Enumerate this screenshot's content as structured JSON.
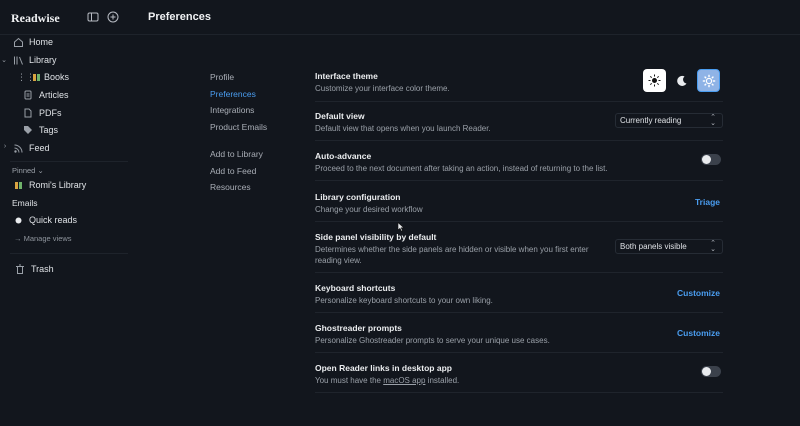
{
  "app": {
    "brand": "Readwise",
    "page_title": "Preferences"
  },
  "sidebar": {
    "home": "Home",
    "library": "Library",
    "library_items": [
      {
        "label": "Books",
        "icon": "books-icon"
      },
      {
        "label": "Articles",
        "icon": "article-icon"
      },
      {
        "label": "PDFs",
        "icon": "pdf-icon"
      },
      {
        "label": "Tags",
        "icon": "tag-icon"
      }
    ],
    "feed": "Feed",
    "pinned_label": "Pinned",
    "pinned_items": [
      {
        "label": "Romi's Library",
        "icon": "books-icon"
      }
    ],
    "emails_label": "Emails",
    "quick_reads": "Quick reads",
    "manage_views": "Manage views",
    "trash": "Trash"
  },
  "subnav": {
    "items": [
      "Profile",
      "Preferences",
      "Integrations",
      "Product Emails"
    ],
    "active": "Preferences",
    "secondary": [
      "Add to Library",
      "Add to Feed",
      "Resources"
    ]
  },
  "settings": [
    {
      "title": "Interface theme",
      "desc": "Customize your interface color theme.",
      "control": "theme"
    },
    {
      "title": "Default view",
      "desc": "Default view that opens when you launch Reader.",
      "control": "select",
      "value": "Currently reading"
    },
    {
      "title": "Auto-advance",
      "desc": "Proceed to the next document after taking an action, instead of returning to the list.",
      "control": "toggle",
      "on": false
    },
    {
      "title": "Library configuration",
      "desc": "Change your desired workflow",
      "control": "link",
      "value": "Triage"
    },
    {
      "title": "Side panel visibility by default",
      "desc": "Determines whether the side panels are hidden or visible when you first enter reading view.",
      "control": "select",
      "value": "Both panels visible"
    },
    {
      "title": "Keyboard shortcuts",
      "desc": "Personalize keyboard shortcuts to your own liking.",
      "control": "link",
      "value": "Customize"
    },
    {
      "title": "Ghostreader prompts",
      "desc": "Personalize Ghostreader prompts to serve your unique use cases.",
      "control": "link",
      "value": "Customize"
    },
    {
      "title": "Open Reader links in desktop app",
      "desc_before": "You must have the ",
      "desc_link": "macOS app",
      "desc_after": " installed.",
      "control": "toggle",
      "on": false
    }
  ],
  "theme": {
    "options": [
      "light",
      "dark",
      "system"
    ],
    "selected": "system",
    "colors": {
      "light_bg": "#ffffff",
      "system_bg": "#8fb3e6",
      "accent": "#4a9df0"
    }
  }
}
